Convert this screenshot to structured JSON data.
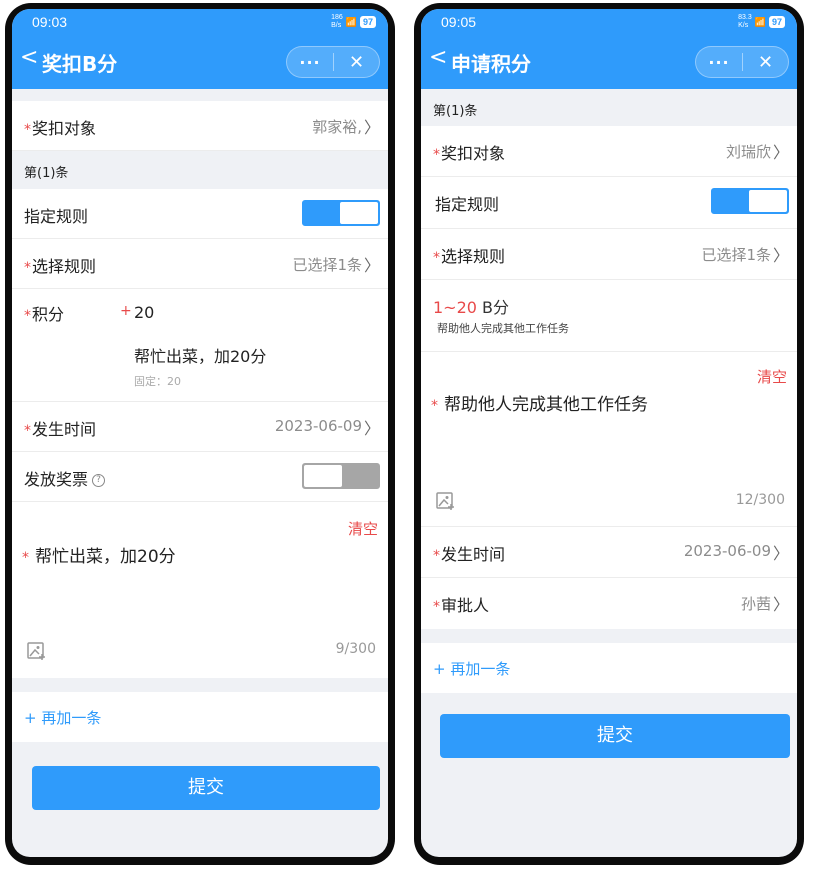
{
  "left": {
    "status": {
      "time": "09:03",
      "speed": "186\nB/s",
      "battery": "97"
    },
    "nav": {
      "back": "<",
      "title": "奖扣B分",
      "more": "···",
      "close": "✕"
    },
    "target": {
      "label": "奖扣对象",
      "value": "郭家裕,"
    },
    "section": "第(1)条",
    "rule_toggle": {
      "label": "指定规则"
    },
    "select_rule": {
      "label": "选择规则",
      "value": "已选择1条"
    },
    "points": {
      "label": "积分",
      "prefix": "+",
      "value": "20",
      "desc": "帮忙出菜，加20分",
      "fixed": "固定：20"
    },
    "time": {
      "label": "发生时间",
      "value": "2023-06-09"
    },
    "ticket": {
      "label": "发放奖票",
      "help": "?"
    },
    "remark": {
      "clear": "清空",
      "star": "*",
      "text": "帮忙出菜，加20分",
      "counter": "9/300"
    },
    "add_more": "+ 再加一条",
    "submit": "提交"
  },
  "right": {
    "status": {
      "time": "09:05",
      "speed": "83.3\nK/s",
      "battery": "97"
    },
    "nav": {
      "back": "<",
      "title": "申请积分",
      "more": "···",
      "close": "✕"
    },
    "section": "第(1)条",
    "target": {
      "label": "奖扣对象",
      "value": "刘瑞欣"
    },
    "rule_toggle": {
      "label": "指定规则"
    },
    "select_rule": {
      "label": "选择规则",
      "value": "已选择1条"
    },
    "rule_info": {
      "range": "1~20",
      "unit": "B分",
      "desc": "帮助他人完成其他工作任务"
    },
    "remark": {
      "clear": "清空",
      "star": "*",
      "text": "帮助他人完成其他工作任务",
      "counter": "12/300"
    },
    "time": {
      "label": "发生时间",
      "value": "2023-06-09"
    },
    "approver": {
      "label": "审批人",
      "value": "孙茜"
    },
    "add_more": "+ 再加一条",
    "submit": "提交"
  },
  "colors": {
    "primary": "#2f9bfb",
    "danger": "#e84a4a",
    "background": "#eff1f5"
  }
}
